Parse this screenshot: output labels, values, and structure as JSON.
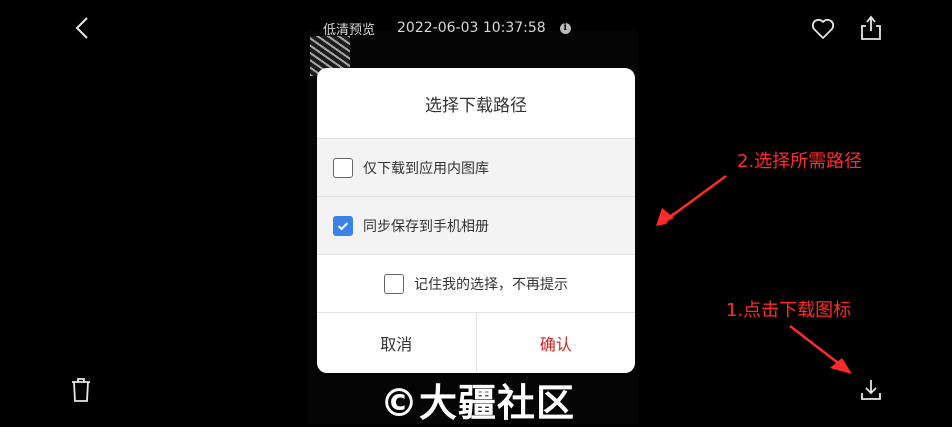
{
  "header": {
    "quality_label": "低清预览",
    "datetime": "2022-06-03 10:37:58",
    "info_glyph": "i"
  },
  "dialog": {
    "title": "选择下载路径",
    "options": [
      {
        "label": "仅下载到应用内图库",
        "checked": false
      },
      {
        "label": "同步保存到手机相册",
        "checked": true
      },
      {
        "label": "记住我的选择，不再提示",
        "checked": false
      }
    ],
    "cancel_label": "取消",
    "confirm_label": "确认"
  },
  "annotations": {
    "step2": "2.选择所需路径",
    "step1": "1.点击下载图标"
  },
  "watermark": "©大疆社区",
  "colors": {
    "accent_blue": "#3b82e8",
    "confirm_red": "#d12626",
    "annotation_red": "#ff2a2a"
  },
  "icons": [
    "back-arrow-icon",
    "info-icon",
    "heart-icon",
    "share-icon",
    "trash-icon",
    "download-icon",
    "checkmark-icon"
  ]
}
